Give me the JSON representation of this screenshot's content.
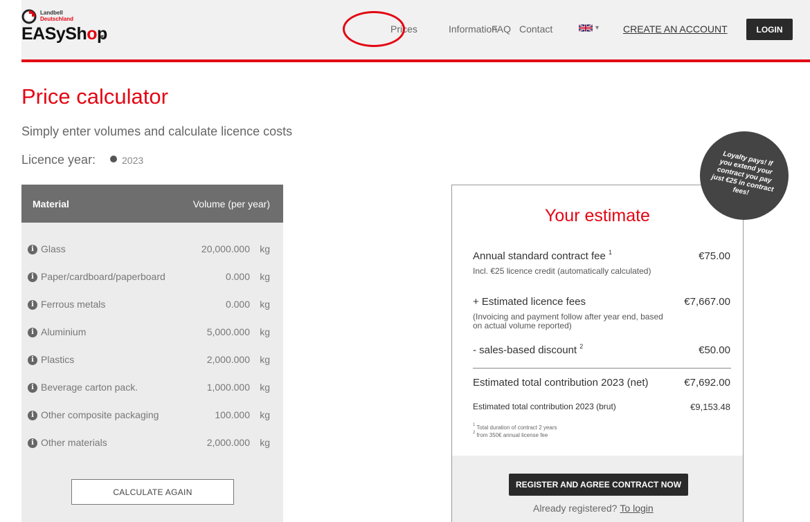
{
  "header": {
    "logo_line1": "Landbell",
    "logo_line2": "Deutschland",
    "logo_main_a": "EASySh",
    "logo_main_b": "o",
    "logo_main_c": "p",
    "logo_caret": "▾",
    "nav": {
      "prices": "Prices",
      "information": "Information",
      "faq": "FAQ",
      "contact": "Contact"
    },
    "lang_caret": "▾",
    "create_account": "CREATE AN ACCOUNT",
    "login": "LOGIN",
    "accent_color": "#e30613"
  },
  "page": {
    "title": "Price calculator",
    "subtitle": "Simply enter volumes and calculate licence costs",
    "licence_label": "Licence year:",
    "licence_year": "2023"
  },
  "materials": {
    "header_material": "Material",
    "header_volume": "Volume (per year)",
    "rows": [
      {
        "name": "Glass",
        "volume": "20,000.000",
        "unit": "kg"
      },
      {
        "name": "Paper/cardboard/paperboard",
        "volume": "0.000",
        "unit": "kg"
      },
      {
        "name": "Ferrous metals",
        "volume": "0.000",
        "unit": "kg"
      },
      {
        "name": "Aluminium",
        "volume": "5,000.000",
        "unit": "kg"
      },
      {
        "name": "Plastics",
        "volume": "2,000.000",
        "unit": "kg"
      },
      {
        "name": "Beverage carton pack.",
        "volume": "1,000.000",
        "unit": "kg"
      },
      {
        "name": "Other composite packaging",
        "volume": "100.000",
        "unit": "kg"
      },
      {
        "name": "Other materials",
        "volume": "2,000.000",
        "unit": "kg"
      }
    ],
    "info_glyph": "i",
    "calculate_again": "CALCULATE AGAIN"
  },
  "estimate": {
    "title": "Your estimate",
    "annual_fee_label": "Annual standard contract fee",
    "annual_fee_sup": "1",
    "annual_fee_note": "Incl. €25 licence credit (automatically calculated)",
    "annual_fee_value": "€75.00",
    "licence_fees_label": "+ Estimated licence fees",
    "licence_fees_note": "(Invoicing and payment follow after year end, based on actual volume reported)",
    "licence_fees_value": "€7,667.00",
    "discount_label": "- sales-based discount",
    "discount_sup": "2",
    "discount_value": "€50.00",
    "net_label": "Estimated total contribution 2023 (net)",
    "net_value": "€7,692.00",
    "brut_label": "Estimated total contribution 2023 (brut)",
    "brut_value": "€9,153.48",
    "foot1_sup": "1",
    "foot1": "Total duration of contract 2 years",
    "foot2_sup": "2",
    "foot2": "from 350€ annual license fee",
    "register_button": "REGISTER AND AGREE CONTRACT NOW",
    "already_registered": "Already registered?",
    "to_login": "To login"
  },
  "loyalty_badge": "Loyalty pays! If you extend your contract you pay just €25 in contract fees!"
}
